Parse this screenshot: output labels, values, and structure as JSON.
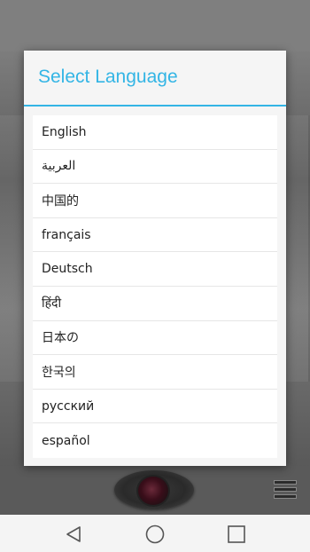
{
  "dialog": {
    "title": "Select Language",
    "languages": [
      {
        "label": "English",
        "direction": "ltr"
      },
      {
        "label": "العربية",
        "direction": "rtl"
      },
      {
        "label": "中国的",
        "direction": "ltr"
      },
      {
        "label": "français",
        "direction": "ltr"
      },
      {
        "label": "Deutsch",
        "direction": "ltr"
      },
      {
        "label": "हिंदी",
        "direction": "ltr"
      },
      {
        "label": "日本の",
        "direction": "ltr"
      },
      {
        "label": "한국의",
        "direction": "ltr"
      },
      {
        "label": "русский",
        "direction": "ltr"
      },
      {
        "label": "español",
        "direction": "ltr"
      }
    ]
  },
  "background_app": {
    "capture_icon": "camera-lens-icon",
    "menu_icon": "menu-icon"
  },
  "nav_bar": {
    "back_icon": "back-triangle-icon",
    "home_icon": "home-circle-icon",
    "recents_icon": "recents-square-icon"
  },
  "colors": {
    "accent": "#33b5e5",
    "dialog_bg": "#f5f5f5",
    "list_bg": "#ffffff",
    "text": "#222222"
  }
}
